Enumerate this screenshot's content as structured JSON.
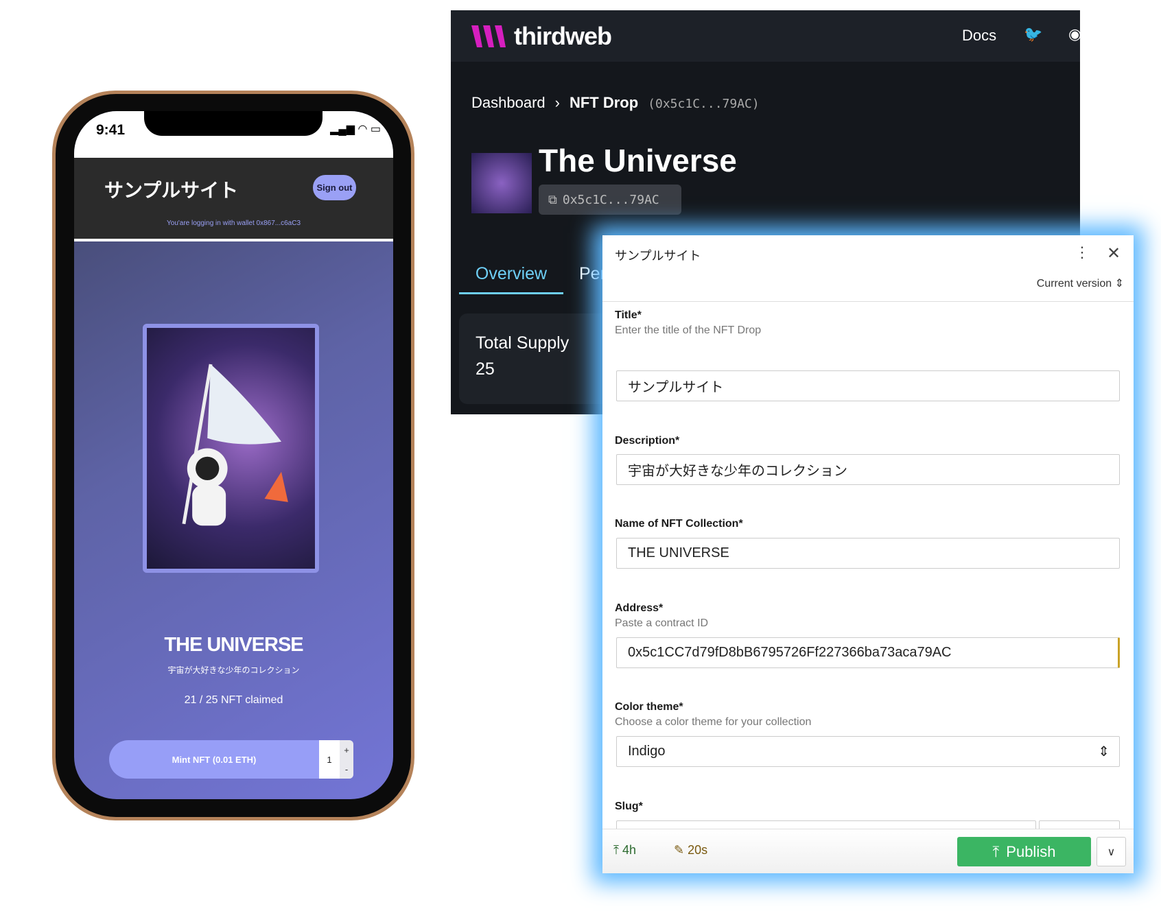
{
  "phone": {
    "time": "9:41",
    "status_icons": "signal wifi battery",
    "site_title": "サンプルサイト",
    "sign_out": "Sign out",
    "wallet_text": "You'are logging in with wallet 0x867...c6aC3",
    "collection_name": "THE UNIVERSE",
    "collection_desc": "宇宙が大好きな少年のコレクション",
    "claimed": "21 / 25 NFT claimed",
    "mint_label": "Mint NFT (0.01 ETH)",
    "quantity": "1",
    "plus": "+",
    "minus": "-"
  },
  "dashboard": {
    "brand": "thirdweb",
    "nav_docs": "Docs",
    "breadcrumb": {
      "root": "Dashboard",
      "sep": "›",
      "current": "NFT Drop",
      "address": "(0x5c1C...79AC)"
    },
    "title": "The Universe",
    "address_chip": "0x5c1C...79AC",
    "tabs": [
      "Overview",
      "Per"
    ],
    "supply_label": "Total Supply",
    "supply_value": "25",
    "accent": "#6ecff6"
  },
  "modal": {
    "title": "サンプルサイト",
    "version": "Current version",
    "fields": [
      {
        "label": "Title*",
        "hint": "Enter the title of the NFT Drop",
        "value": "サンプルサイト"
      },
      {
        "label": "Description*",
        "value": "宇宙が大好きな少年のコレクション"
      },
      {
        "label": "Name of NFT Collection*",
        "value": "THE UNIVERSE"
      },
      {
        "label": "Address*",
        "hint": "Paste a contract ID",
        "value": "0x5c1CC7d79fD8bB6795726Ff227366ba73aca79AC"
      },
      {
        "label": "Color theme*",
        "hint": "Choose a color theme for your collection",
        "value": "Indigo"
      },
      {
        "label": "Slug*"
      }
    ],
    "footer": {
      "published_ago": "4h",
      "edited_ago": "20s",
      "publish": "Publish"
    },
    "publish_color": "#3bb563"
  }
}
